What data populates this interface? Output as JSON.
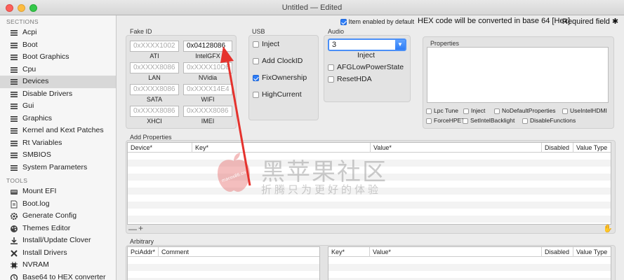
{
  "window": {
    "title": "Untitled — Edited"
  },
  "sidebar": {
    "sections_header": "SECTIONS",
    "sections": [
      {
        "label": "Acpi",
        "icon": "list-icon"
      },
      {
        "label": "Boot",
        "icon": "list-icon"
      },
      {
        "label": "Boot Graphics",
        "icon": "list-icon"
      },
      {
        "label": "Cpu",
        "icon": "list-icon"
      },
      {
        "label": "Devices",
        "icon": "list-icon",
        "selected": true
      },
      {
        "label": "Disable Drivers",
        "icon": "list-icon"
      },
      {
        "label": "Gui",
        "icon": "list-icon"
      },
      {
        "label": "Graphics",
        "icon": "list-icon"
      },
      {
        "label": "Kernel and Kext Patches",
        "icon": "list-icon"
      },
      {
        "label": "Rt Variables",
        "icon": "list-icon"
      },
      {
        "label": "SMBIOS",
        "icon": "list-icon"
      },
      {
        "label": "System Parameters",
        "icon": "list-icon"
      }
    ],
    "tools_header": "TOOLS",
    "tools": [
      {
        "label": "Mount EFI",
        "icon": "disk-icon"
      },
      {
        "label": "Boot.log",
        "icon": "document-icon"
      },
      {
        "label": "Generate Config",
        "icon": "gear-icon"
      },
      {
        "label": "Themes Editor",
        "icon": "palette-icon"
      },
      {
        "label": "Install/Update Clover",
        "icon": "download-icon"
      },
      {
        "label": "Install Drivers",
        "icon": "tools-icon"
      },
      {
        "label": "NVRAM",
        "icon": "chip-icon"
      },
      {
        "label": "Base64 to HEX converter",
        "icon": "convert-icon"
      }
    ]
  },
  "topbar": {
    "item_enabled_default": "Item enabled by default",
    "hex_note": "HEX code will be converted in base 64 [Hex]",
    "required_note": "Required field ✱"
  },
  "fake_id": {
    "label": "Fake ID",
    "fields": [
      {
        "value": "0xXXXX1002",
        "caption": "ATI",
        "filled": false
      },
      {
        "value": "0x04128086",
        "caption": "IntelGFX",
        "filled": true
      },
      {
        "value": "0xXXXX8086",
        "caption": "LAN",
        "filled": false
      },
      {
        "value": "0xXXXX10DE",
        "caption": "NVidia",
        "filled": false
      },
      {
        "value": "0xXXXX8086",
        "caption": "SATA",
        "filled": false
      },
      {
        "value": "0xXXXX14E4",
        "caption": "WIFI",
        "filled": false
      },
      {
        "value": "0xXXXX8086",
        "caption": "XHCI",
        "filled": false
      },
      {
        "value": "0xXXXX8086",
        "caption": "IMEI",
        "filled": false
      }
    ]
  },
  "usb": {
    "label": "USB",
    "options": [
      {
        "label": "Inject",
        "checked": false
      },
      {
        "label": "Add ClockID",
        "checked": false
      },
      {
        "label": "FixOwnership",
        "checked": true
      },
      {
        "label": "HighCurrent",
        "checked": false
      }
    ]
  },
  "audio": {
    "label": "Audio",
    "select_value": "3",
    "inject_label": "Inject",
    "options": [
      {
        "label": "AFGLowPowerState",
        "checked": false
      },
      {
        "label": "ResetHDA",
        "checked": false
      }
    ]
  },
  "properties": {
    "label": "Properties",
    "options": [
      {
        "label": "Lpc Tune",
        "checked": false
      },
      {
        "label": "Inject",
        "checked": false
      },
      {
        "label": "NoDefaultProperties",
        "checked": false
      },
      {
        "label": "UseIntelHDMI",
        "checked": false
      },
      {
        "label": "ForceHPET",
        "checked": false
      },
      {
        "label": "SetIntelBacklight",
        "checked": false
      },
      {
        "label": "DisableFunctions",
        "checked": false
      }
    ]
  },
  "add_properties": {
    "label": "Add Properties",
    "columns": [
      "Device*",
      "Key*",
      "Value*",
      "Disabled",
      "Value Type"
    ],
    "minus": "—",
    "plus": "+"
  },
  "arbitrary": {
    "label": "Arbitrary",
    "left_columns": [
      "PciAddr*",
      "Comment"
    ],
    "right_columns": [
      "Key*",
      "Value*",
      "Disabled",
      "Value Type"
    ]
  },
  "watermark": {
    "title": "黑苹果社区",
    "subtitle": "折腾只为更好的体验",
    "logo_text": "macos86.cn"
  },
  "colors": {
    "accent": "#2d7cf6",
    "arrow": "#e5322d",
    "selection": "#d8d8d8"
  }
}
